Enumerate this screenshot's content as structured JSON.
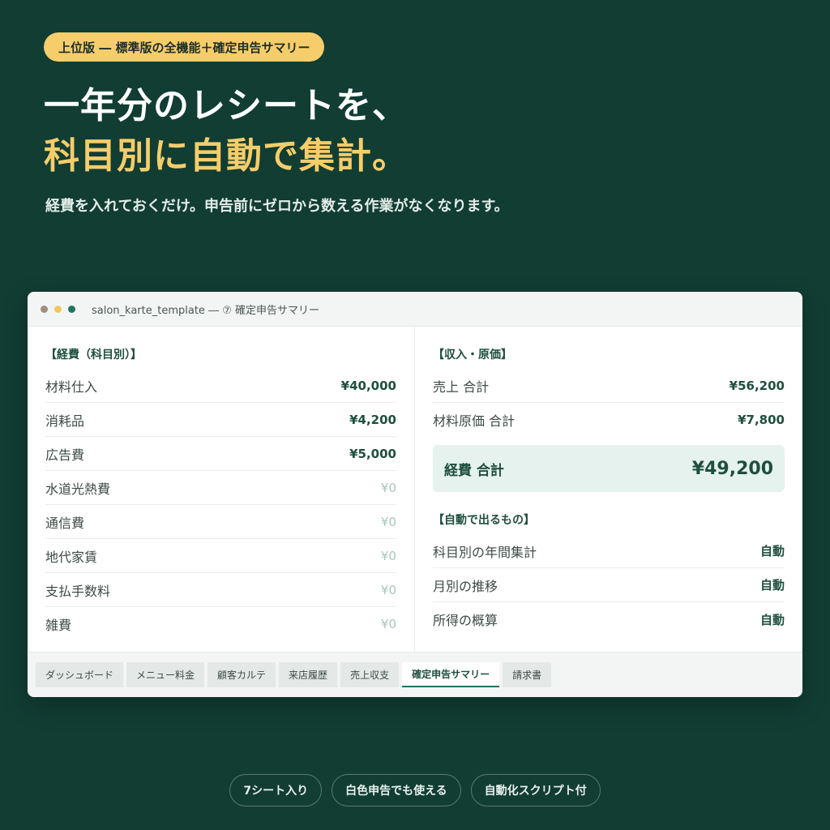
{
  "badge": "上位版 ― 標準版の全機能＋確定申告サマリー",
  "headline": {
    "line1": "一年分のレシートを、",
    "line2": "科目別に自動で集計。"
  },
  "subline": "経費を入れておくだけ。申告前にゼロから数える作業がなくなります。",
  "window": {
    "title": "salon_karte_template ― ⑦ 確定申告サマリー",
    "colors": {
      "dot1": "#a08f7d",
      "dot2": "#f0c85e",
      "dot3": "#1d7560"
    }
  },
  "expenses": {
    "title": "【経費（科目別）】",
    "rows": [
      {
        "label": "材料仕入",
        "value": "¥40,000"
      },
      {
        "label": "消耗品",
        "value": "¥4,200"
      },
      {
        "label": "広告費",
        "value": "¥5,000"
      },
      {
        "label": "水道光熱費",
        "value": "¥0"
      },
      {
        "label": "通信費",
        "value": "¥0"
      },
      {
        "label": "地代家賃",
        "value": "¥0"
      },
      {
        "label": "支払手数料",
        "value": "¥0"
      },
      {
        "label": "雑費",
        "value": "¥0"
      }
    ]
  },
  "income": {
    "title": "【収入・原価】",
    "rows": [
      {
        "label": "売上 合計",
        "value": "¥56,200"
      },
      {
        "label": "材料原価 合計",
        "value": "¥7,800"
      }
    ],
    "total_label": "経費 合計",
    "total_value": "¥49,200"
  },
  "auto": {
    "title": "【自動で出るもの】",
    "rows": [
      {
        "label": "科目別の年間集計",
        "value": "自動"
      },
      {
        "label": "月別の推移",
        "value": "自動"
      },
      {
        "label": "所得の概算",
        "value": "自動"
      }
    ]
  },
  "tabs": [
    "ダッシュボード",
    "メニュー料金",
    "顧客カルテ",
    "来店履歴",
    "売上収支",
    "確定申告サマリー",
    "請求書"
  ],
  "active_tab": "確定申告サマリー",
  "pills": [
    "7シート入り",
    "白色申告でも使える",
    "自動化スクリプト付"
  ]
}
